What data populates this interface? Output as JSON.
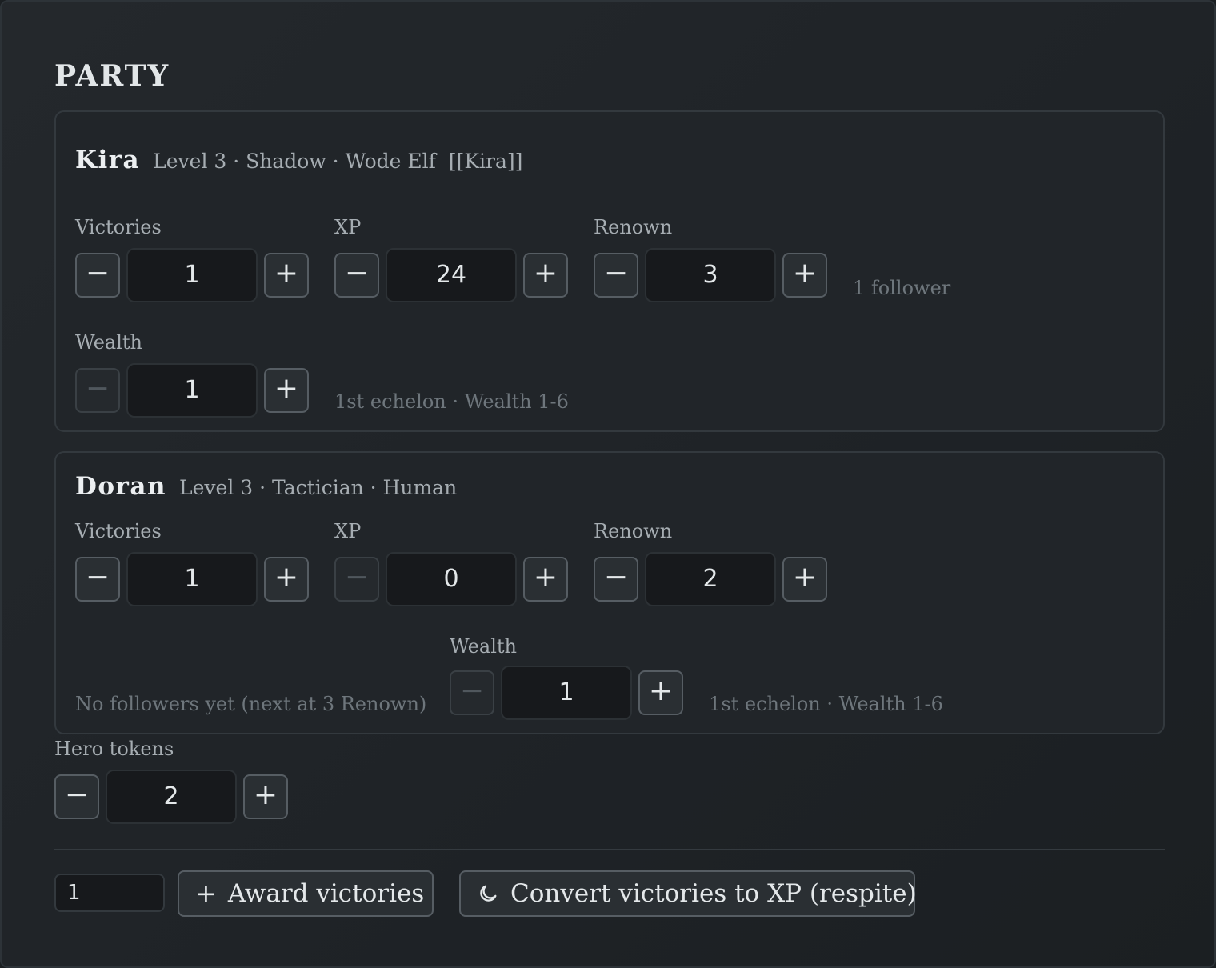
{
  "title": "PARTY",
  "heroes": [
    {
      "name": "Kira",
      "meta": "Level 3 · Shadow · Wode Elf",
      "link": "[[Kira]]",
      "victories": {
        "label": "Victories",
        "value": "1"
      },
      "xp": {
        "label": "XP",
        "value": "24"
      },
      "renown": {
        "label": "Renown",
        "value": "3",
        "note": "1 follower"
      },
      "wealth": {
        "label": "Wealth",
        "value": "1",
        "note": "1st echelon · Wealth 1-6"
      }
    },
    {
      "name": "Doran",
      "meta": "Level 3 · Tactician · Human",
      "victories": {
        "label": "Victories",
        "value": "1"
      },
      "xp": {
        "label": "XP",
        "value": "0"
      },
      "renown": {
        "label": "Renown",
        "value": "2",
        "note": "No followers yet (next at 3 Renown)"
      },
      "wealth": {
        "label": "Wealth",
        "value": "1",
        "note": "1st echelon · Wealth 1-6"
      }
    }
  ],
  "hero_tokens": {
    "label": "Hero tokens",
    "value": "2"
  },
  "controls": {
    "minus_glyph": "−",
    "plus_glyph": "+"
  },
  "actions": {
    "award_count": "1",
    "award_label": "Award victories",
    "convert_label": "Convert victories to XP (respite)"
  },
  "icons": {
    "award": "plus-icon",
    "convert": "moon-icon"
  }
}
